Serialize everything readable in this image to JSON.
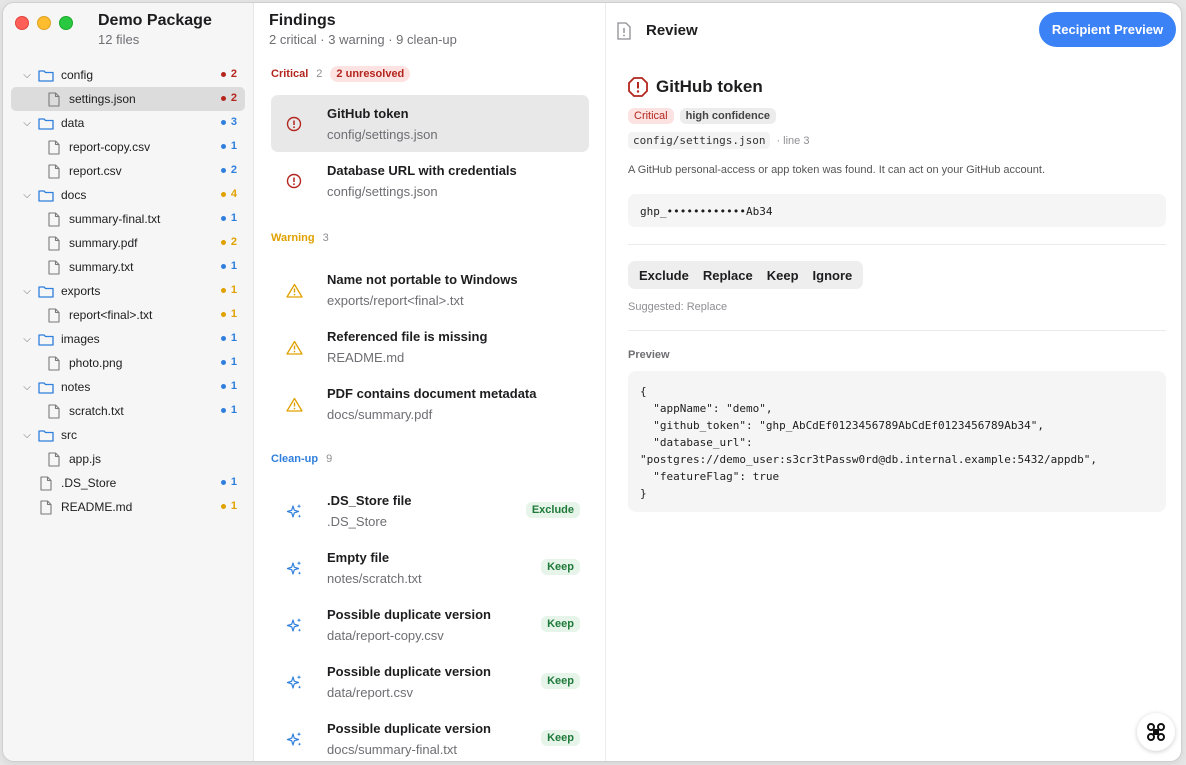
{
  "colors": {
    "critical": "#b3261e",
    "warning": "#e0a100",
    "cleanup": "#2f7fdc",
    "info_dot": "#2f7fdc",
    "accent": "#3b82f6"
  },
  "sidebar": {
    "title": "Demo Package",
    "subtitle": "12 files",
    "tree": [
      {
        "name": "config",
        "type": "folder",
        "level": 0,
        "count": "2",
        "severity": "critical"
      },
      {
        "name": "settings.json",
        "type": "file",
        "level": 1,
        "count": "2",
        "severity": "critical",
        "selected": true
      },
      {
        "name": "data",
        "type": "folder",
        "level": 0,
        "count": "3",
        "severity": "info"
      },
      {
        "name": "report-copy.csv",
        "type": "file",
        "level": 1,
        "count": "1",
        "severity": "info"
      },
      {
        "name": "report.csv",
        "type": "file",
        "level": 1,
        "count": "2",
        "severity": "info"
      },
      {
        "name": "docs",
        "type": "folder",
        "level": 0,
        "count": "4",
        "severity": "warning"
      },
      {
        "name": "summary-final.txt",
        "type": "file",
        "level": 1,
        "count": "1",
        "severity": "info"
      },
      {
        "name": "summary.pdf",
        "type": "file",
        "level": 1,
        "count": "2",
        "severity": "warning"
      },
      {
        "name": "summary.txt",
        "type": "file",
        "level": 1,
        "count": "1",
        "severity": "info"
      },
      {
        "name": "exports",
        "type": "folder",
        "level": 0,
        "count": "1",
        "severity": "warning"
      },
      {
        "name": "report<final>.txt",
        "type": "file",
        "level": 1,
        "count": "1",
        "severity": "warning"
      },
      {
        "name": "images",
        "type": "folder",
        "level": 0,
        "count": "1",
        "severity": "info"
      },
      {
        "name": "photo.png",
        "type": "file",
        "level": 1,
        "count": "1",
        "severity": "info"
      },
      {
        "name": "notes",
        "type": "folder",
        "level": 0,
        "count": "1",
        "severity": "info"
      },
      {
        "name": "scratch.txt",
        "type": "file",
        "level": 1,
        "count": "1",
        "severity": "info"
      },
      {
        "name": "src",
        "type": "folder",
        "level": 0,
        "count": "",
        "severity": ""
      },
      {
        "name": "app.js",
        "type": "file",
        "level": 1,
        "count": "",
        "severity": ""
      },
      {
        "name": ".DS_Store",
        "type": "file",
        "level": 0,
        "count": "1",
        "severity": "info"
      },
      {
        "name": "README.md",
        "type": "file",
        "level": 0,
        "count": "1",
        "severity": "warning"
      }
    ]
  },
  "findings": {
    "title": "Findings",
    "subtitle": "2 critical · 3 warning · 9 clean-up",
    "sections": [
      {
        "key": "critical",
        "label": "Critical",
        "count": "2",
        "pill": "2 unresolved",
        "items": [
          {
            "title": "GitHub token",
            "path": "config/settings.json",
            "selected": true,
            "icon": "alert-circle-icon"
          },
          {
            "title": "Database URL with credentials",
            "path": "config/settings.json",
            "icon": "alert-circle-icon"
          }
        ]
      },
      {
        "key": "warning",
        "label": "Warning",
        "count": "3",
        "items": [
          {
            "title": "Name not portable to Windows",
            "path": "exports/report<final>.txt",
            "icon": "warning-triangle-icon"
          },
          {
            "title": "Referenced file is missing",
            "path": "README.md",
            "icon": "warning-triangle-icon"
          },
          {
            "title": "PDF contains document metadata",
            "path": "docs/summary.pdf",
            "icon": "warning-triangle-icon"
          }
        ]
      },
      {
        "key": "cleanup",
        "label": "Clean-up",
        "count": "9",
        "items": [
          {
            "title": ".DS_Store file",
            "path": ".DS_Store",
            "badge": "Exclude",
            "icon": "sparkles-icon"
          },
          {
            "title": "Empty file",
            "path": "notes/scratch.txt",
            "badge": "Keep",
            "icon": "sparkles-icon"
          },
          {
            "title": "Possible duplicate version",
            "path": "data/report-copy.csv",
            "badge": "Keep",
            "icon": "sparkles-icon"
          },
          {
            "title": "Possible duplicate version",
            "path": "data/report.csv",
            "badge": "Keep",
            "icon": "sparkles-icon"
          },
          {
            "title": "Possible duplicate version",
            "path": "docs/summary-final.txt",
            "badge": "Keep",
            "icon": "sparkles-icon"
          }
        ]
      }
    ]
  },
  "review": {
    "title": "Review",
    "preview_button": "Recipient Preview",
    "detail": {
      "title": "GitHub token",
      "severity": "Critical",
      "confidence": "high confidence",
      "file": "config/settings.json",
      "line": "· line 3",
      "description": "A GitHub personal-access or app token was found. It can act on your GitHub account.",
      "secret": "ghp_••••••••••••Ab34",
      "actions": [
        "Exclude",
        "Replace",
        "Keep",
        "Ignore"
      ],
      "suggested": "Suggested: Replace",
      "preview_label": "Preview",
      "preview_code": "{\n  \"appName\": \"demo\",\n  \"github_token\": \"ghp_AbCdEf0123456789AbCdEf0123456789Ab34\",\n  \"database_url\":\n\"postgres://demo_user:s3cr3tPassw0rd@db.internal.example:5432/appdb\",\n  \"featureFlag\": true\n}"
    }
  }
}
